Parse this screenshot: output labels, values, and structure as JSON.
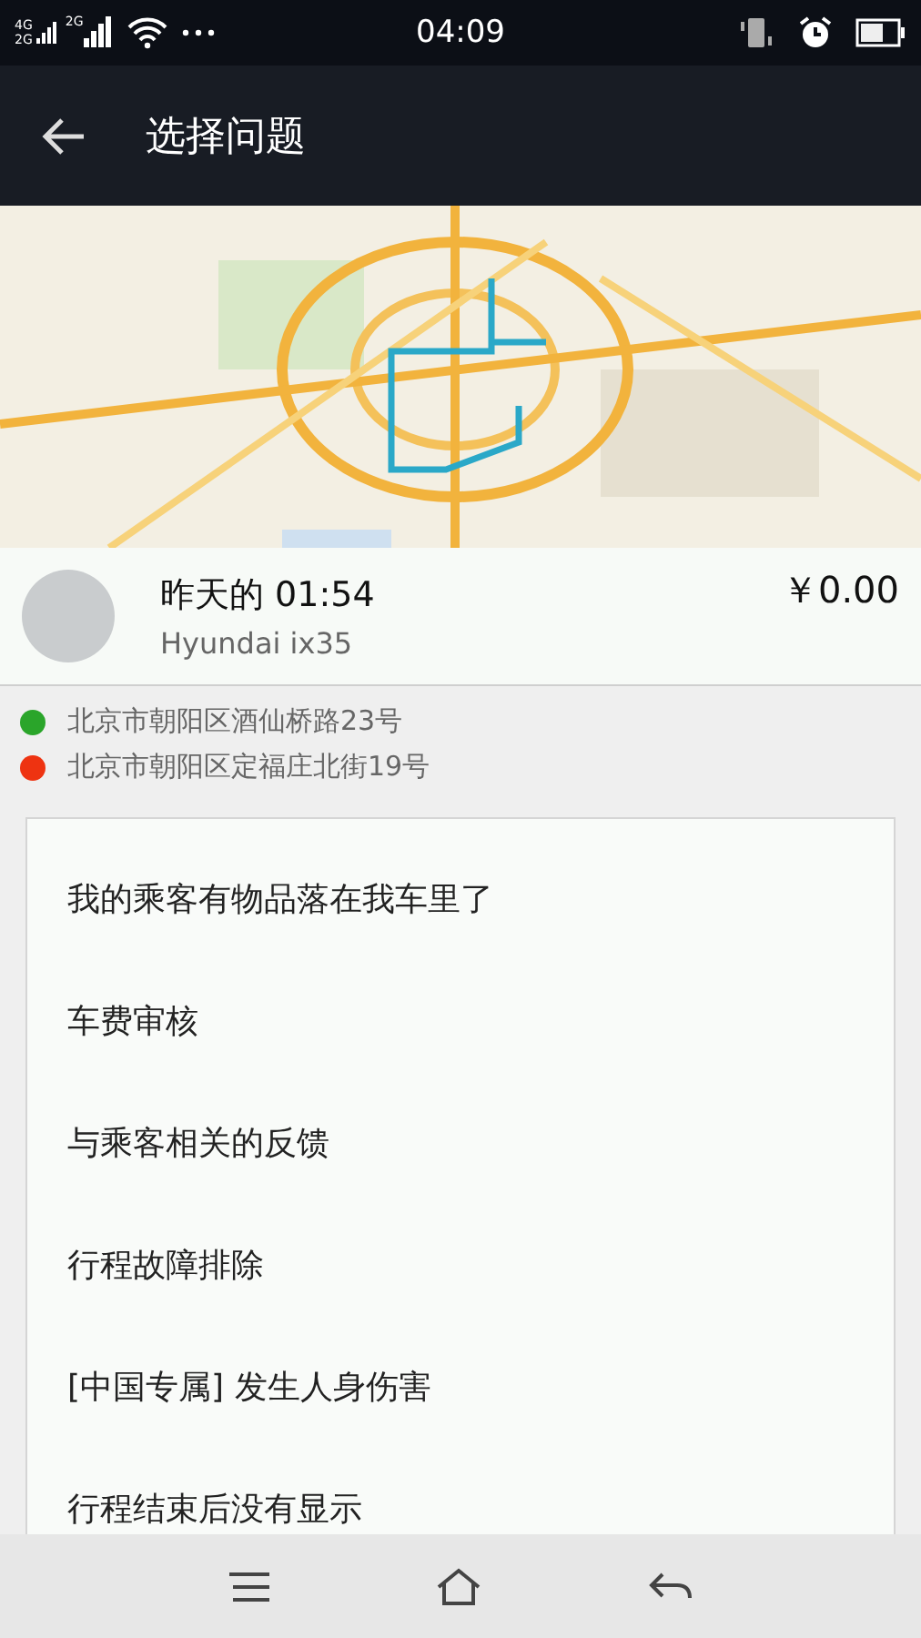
{
  "status_bar": {
    "network_labels": [
      "4G",
      "2G",
      "2G"
    ],
    "time": "04:09"
  },
  "app_bar": {
    "title": "选择问题"
  },
  "trip": {
    "time": "昨天的 01:54",
    "vehicle": "Hyundai ix35",
    "fare": "￥0.00"
  },
  "stops": [
    {
      "address": "北京市朝阳区酒仙桥路23号",
      "color": "#2aa52a"
    },
    {
      "address": "北京市朝阳区定福庄北街19号",
      "color": "#ee3311"
    }
  ],
  "issues": [
    "我的乘客有物品落在我车里了",
    "车费审核",
    "与乘客相关的反馈",
    "行程故障排除",
    "[中国专属] 发生人身伤害",
    "行程结束后没有显示"
  ]
}
